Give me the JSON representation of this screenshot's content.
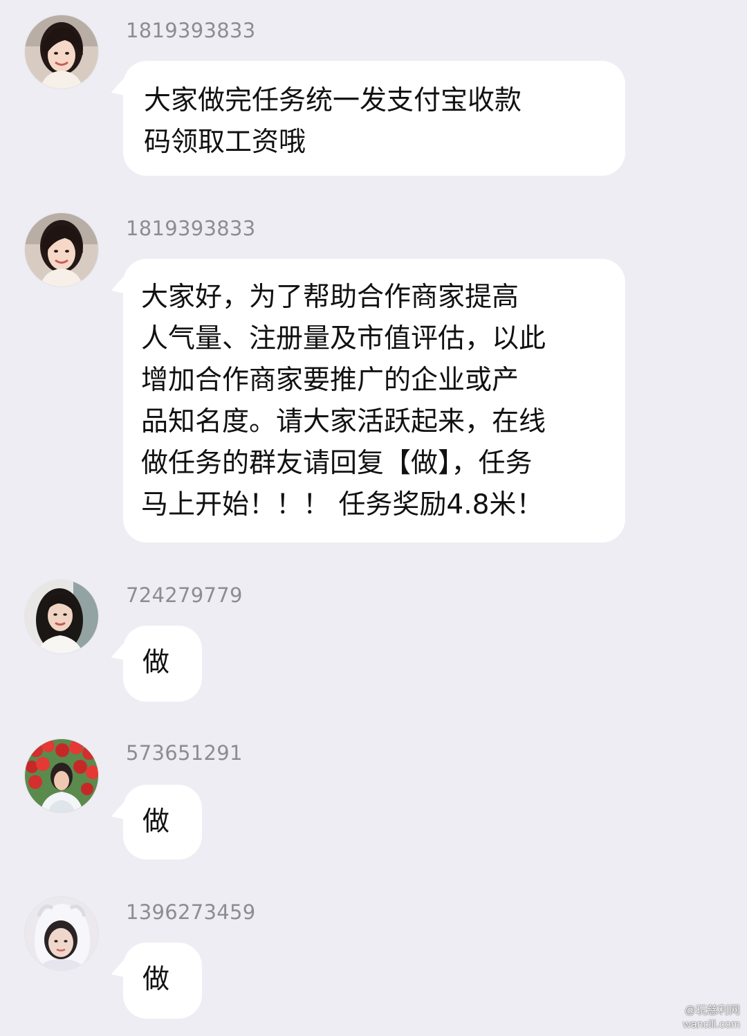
{
  "messages": [
    {
      "sender": "1819393833",
      "avatar": "avatar-woman-smiling",
      "text": "大家做完任务统一发支付宝收款\n码领取工资哦"
    },
    {
      "sender": "1819393833",
      "avatar": "avatar-woman-smiling",
      "text": "大家好，为了帮助合作商家提高\n人气量、注册量及市值评估，以此\n增加合作商家要推广的企业或产\n品知名度。请大家活跃起来，在线\n做任务的群友请回复【做】，任务\n马上开始！！！ 任务奖励4.8米！"
    },
    {
      "sender": "724279779",
      "avatar": "avatar-woman-long-hair",
      "text": "做"
    },
    {
      "sender": "573651291",
      "avatar": "avatar-woman-red-flowers",
      "text": "做"
    },
    {
      "sender": "1396273459",
      "avatar": "avatar-woman-white-hood",
      "text": "做"
    }
  ],
  "watermark": {
    "line1": "@玩慈利网",
    "line2": "wancili.com"
  },
  "colors": {
    "background": "#ededf3",
    "bubble": "#ffffff",
    "sender_text": "#8c8c94",
    "message_text": "#111111"
  }
}
